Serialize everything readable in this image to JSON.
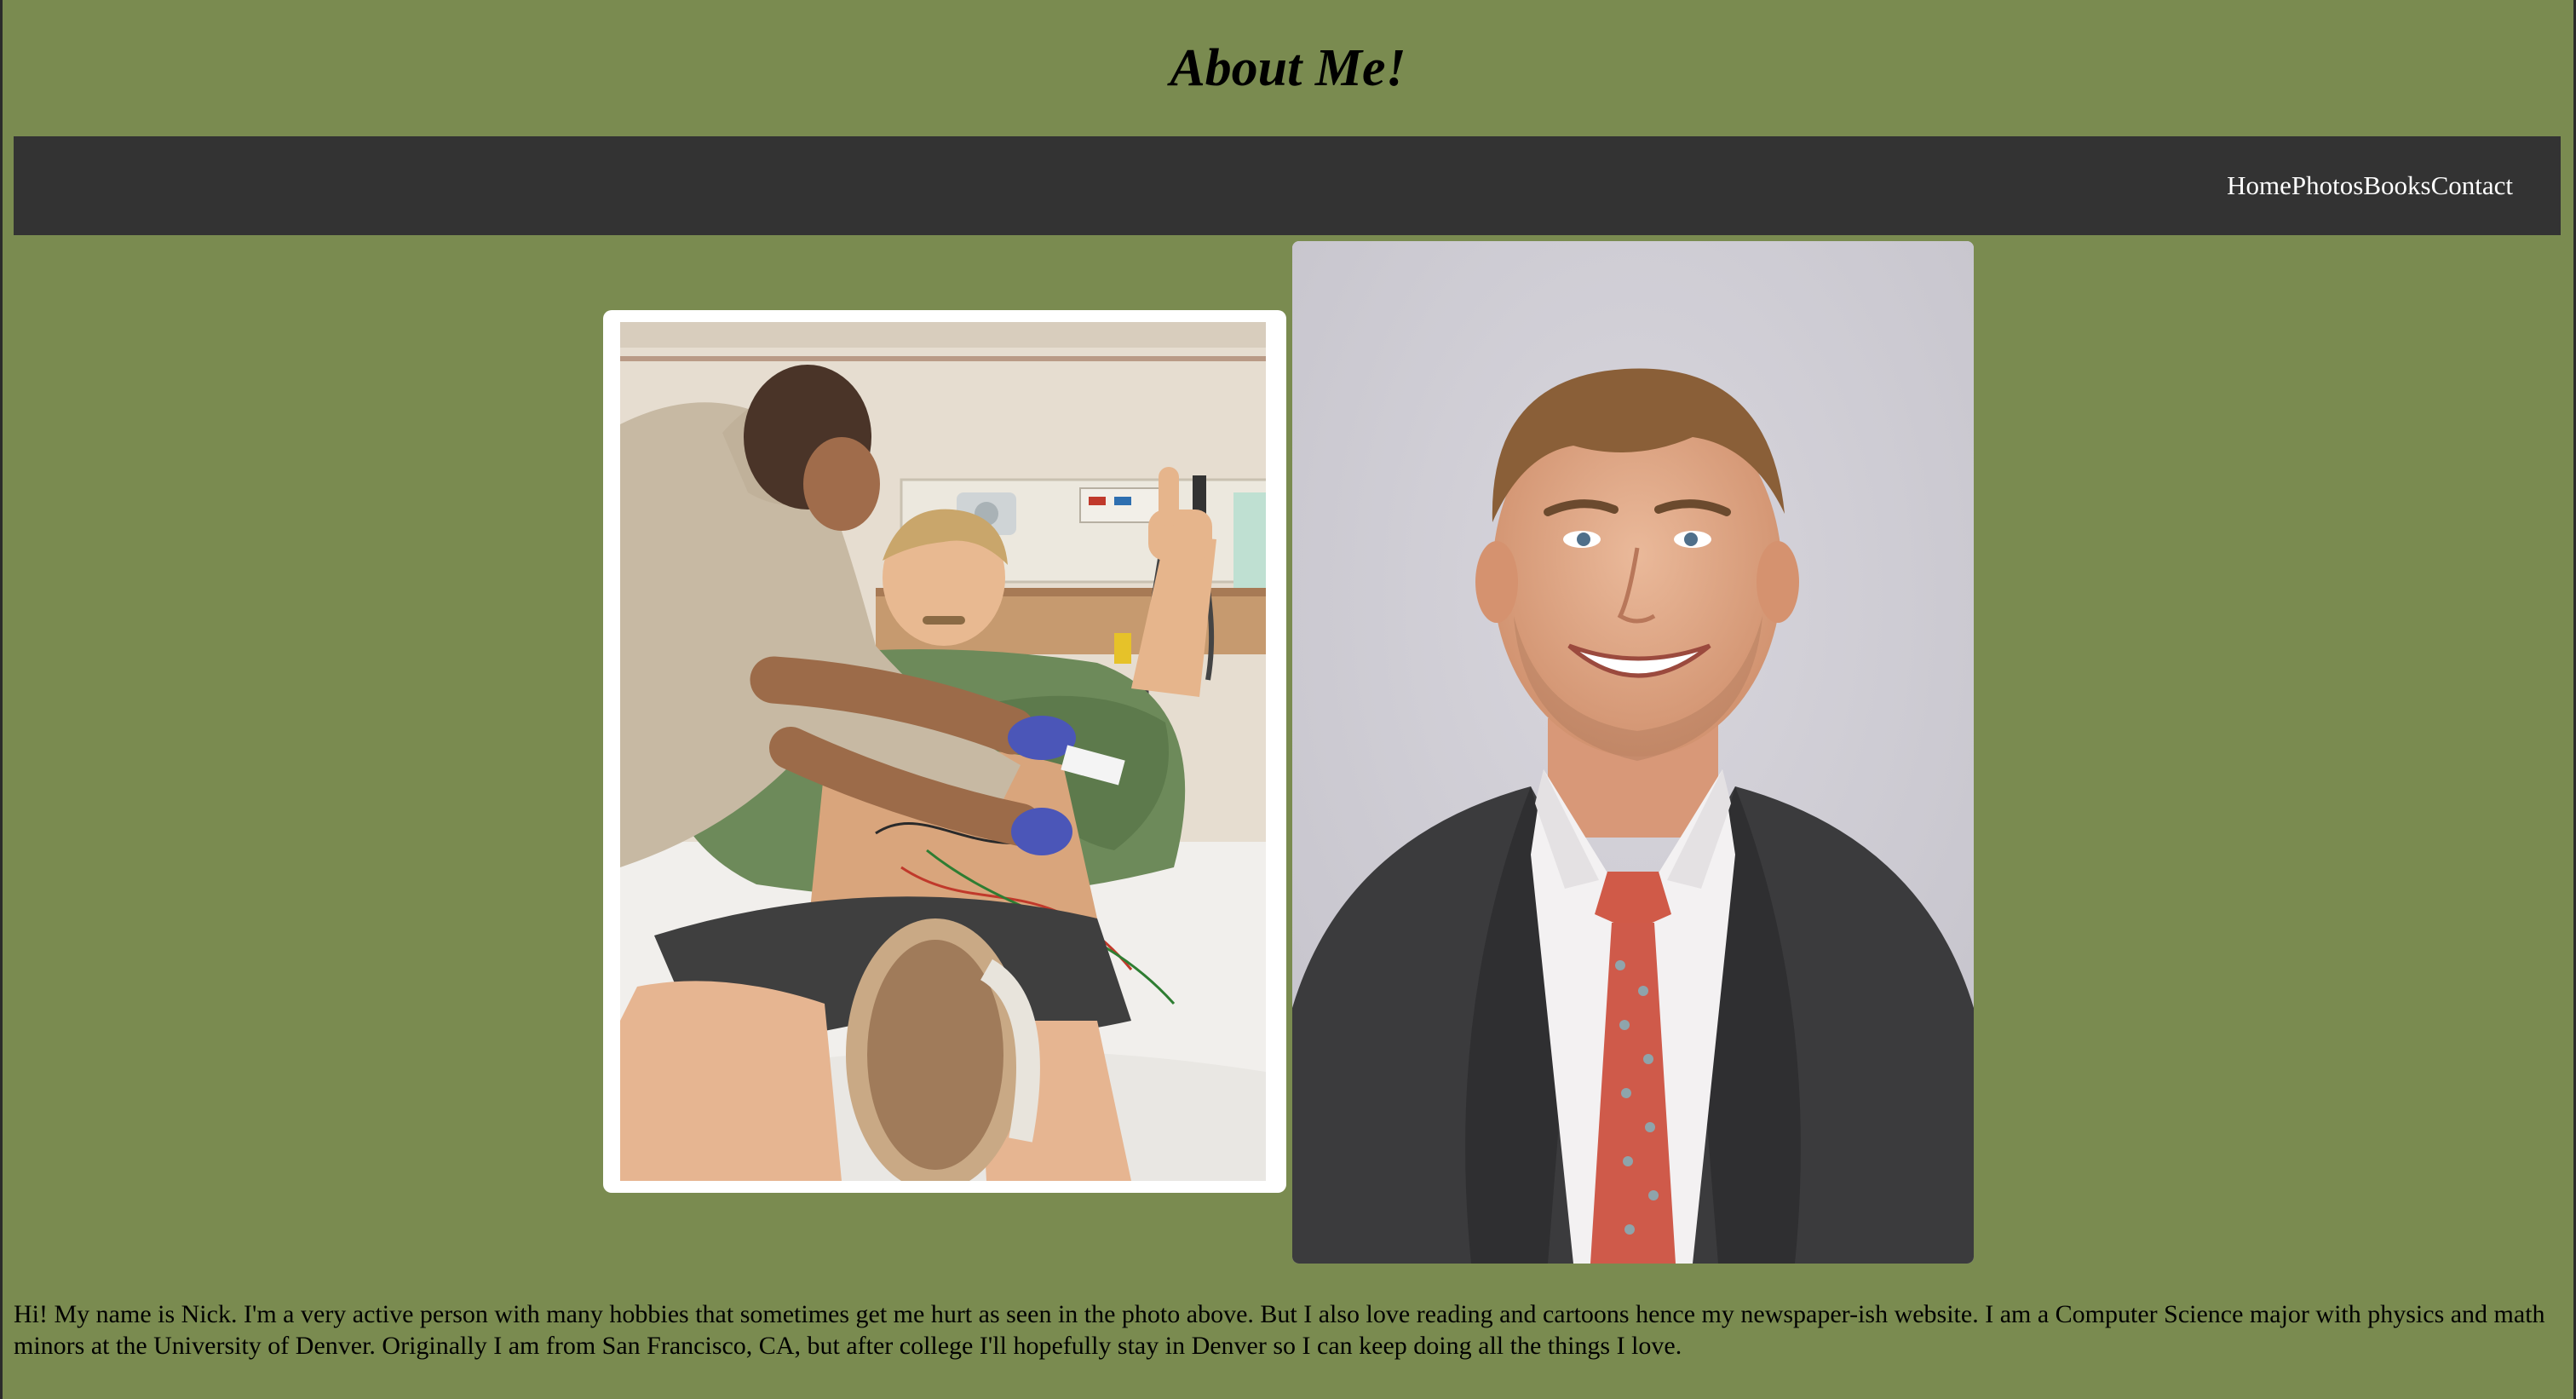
{
  "header": {
    "title": "About Me!"
  },
  "nav": {
    "items": [
      {
        "label": "Home"
      },
      {
        "label": "Photos"
      },
      {
        "label": "Books"
      },
      {
        "label": "Contact"
      }
    ]
  },
  "photos": {
    "hospital_photo_alt": "Nick in a hospital bed giving a thumbs up",
    "portrait_alt": "Portrait of Nick in a suit and tie"
  },
  "bio": {
    "text": "Hi! My name is Nick. I'm a very active person with many hobbies that sometimes get me hurt as seen in the photo above. But I also love reading and cartoons hence my newspaper-ish website. I am a Computer Science major with physics and math minors at the University of Denver. Originally I am from San Francisco, CA, but after college I'll hopefully stay in Denver so I can keep doing all the things I love."
  },
  "colors": {
    "page_background": "#7a8b50",
    "navbar_background": "#333333",
    "nav_text": "#ffffff"
  }
}
